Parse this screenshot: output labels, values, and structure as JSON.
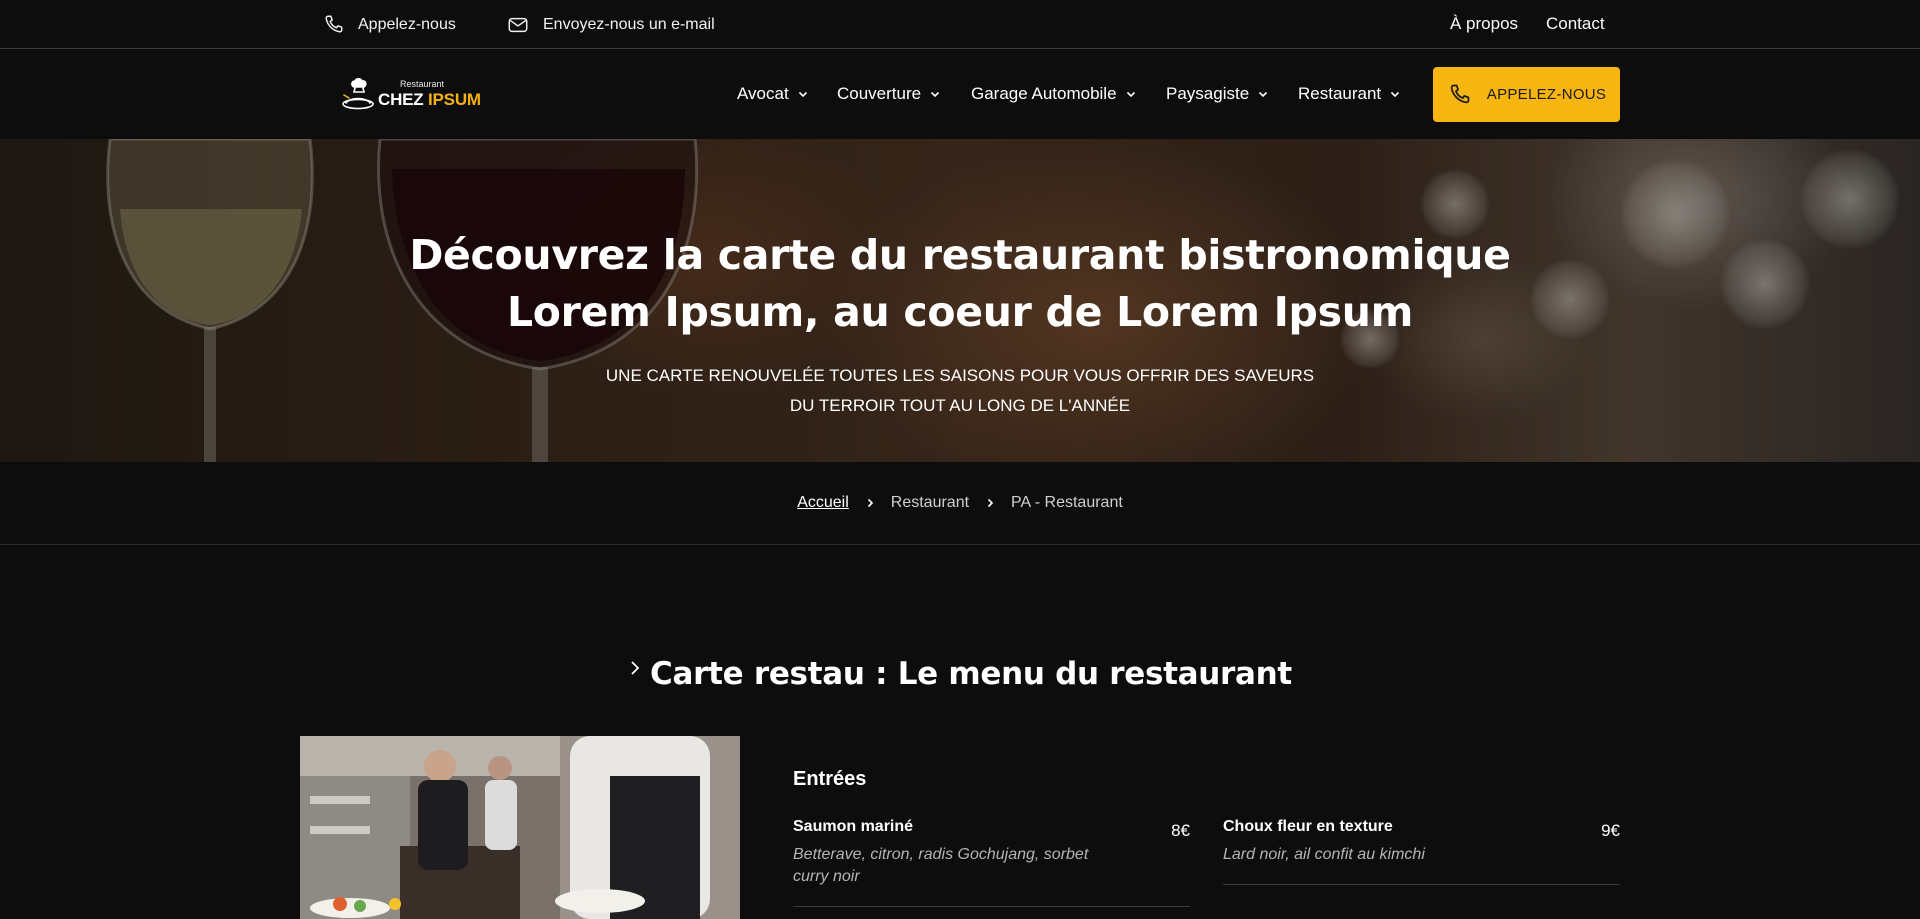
{
  "topbar": {
    "phone_label": "Appelez-nous",
    "email_label": "Envoyez-nous un e-mail",
    "about_label": "À propos",
    "contact_label": "Contact"
  },
  "logo": {
    "small_text": "Restaurant",
    "name_main": "CHEZ ",
    "name_accent": "IPSUM"
  },
  "nav": {
    "items": [
      {
        "label": "Avocat"
      },
      {
        "label": "Couverture"
      },
      {
        "label": "Garage Automobile"
      },
      {
        "label": "Paysagiste"
      },
      {
        "label": "Restaurant"
      }
    ],
    "cta_label": "APPELEZ-NOUS"
  },
  "hero": {
    "title_line1": "Découvrez la carte du restaurant bistronomique",
    "title_line2": "Lorem Ipsum, au coeur de Lorem Ipsum",
    "subtitle_line1": "UNE CARTE RENOUVELÉE TOUTES LES SAISONS POUR VOUS OFFRIR DES SAVEURS",
    "subtitle_line2": "DU TERROIR TOUT AU LONG DE L'ANNÉE"
  },
  "breadcrumb": {
    "home": "Accueil",
    "level1": "Restaurant",
    "current": "PA - Restaurant"
  },
  "section": {
    "title": "Carte restau : Le menu du restaurant"
  },
  "menu": {
    "category": "Entrées",
    "dishes": [
      {
        "name": "Saumon mariné",
        "desc_line1": "Betterave, citron, radis Gochujang, sorbet",
        "desc_line2": "curry noir",
        "price": "8€"
      },
      {
        "name": "Choux fleur en texture",
        "desc_line1": "Lard noir, ail confit au kimchi",
        "desc_line2": "",
        "price": "9€"
      }
    ]
  },
  "colors": {
    "background": "#0d0d0d",
    "accent": "#f7b511"
  },
  "icons": [
    "phone-icon",
    "mail-icon",
    "chevron-down-icon",
    "chevron-right-icon",
    "chef-logo-icon"
  ]
}
